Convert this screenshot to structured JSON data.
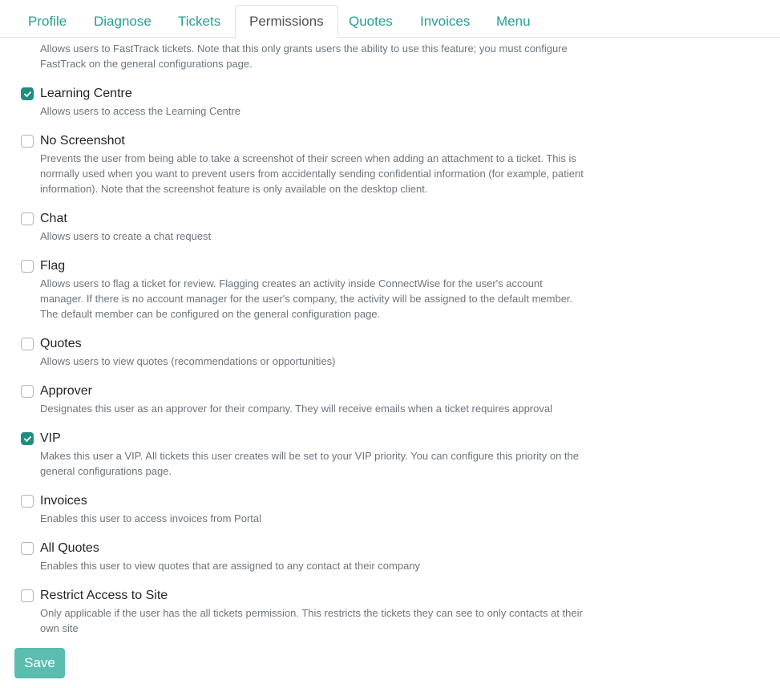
{
  "tabs": [
    {
      "label": "Profile",
      "active": false
    },
    {
      "label": "Diagnose",
      "active": false
    },
    {
      "label": "Tickets",
      "active": false
    },
    {
      "label": "Permissions",
      "active": true
    },
    {
      "label": "Quotes",
      "active": false
    },
    {
      "label": "Invoices",
      "active": false
    },
    {
      "label": "Menu",
      "active": false
    }
  ],
  "intro_description": "Allows users to FastTrack tickets. Note that this only grants users the ability to use this feature; you must configure FastTrack on the general configurations page.",
  "permissions": [
    {
      "label": "Learning Centre",
      "checked": true,
      "description": "Allows users to access the Learning Centre"
    },
    {
      "label": "No Screenshot",
      "checked": false,
      "description": "Prevents the user from being able to take a screenshot of their screen when adding an attachment to a ticket. This is normally used when you want to prevent users from accidentally sending confidential information (for example, patient information). Note that the screenshot feature is only available on the desktop client."
    },
    {
      "label": "Chat",
      "checked": false,
      "description": "Allows users to create a chat request"
    },
    {
      "label": "Flag",
      "checked": false,
      "description": "Allows users to flag a ticket for review. Flagging creates an activity inside ConnectWise for the user's account manager. If there is no account manager for the user's company, the activity will be assigned to the default member. The default member can be configured on the general configuration page."
    },
    {
      "label": "Quotes",
      "checked": false,
      "description": "Allows users to view quotes (recommendations or opportunities)"
    },
    {
      "label": "Approver",
      "checked": false,
      "description": "Designates this user as an approver for their company. They will receive emails when a ticket requires approval"
    },
    {
      "label": "VIP",
      "checked": true,
      "description": "Makes this user a VIP. All tickets this user creates will be set to your VIP priority. You can configure this priority on the general configurations page."
    },
    {
      "label": "Invoices",
      "checked": false,
      "description": "Enables this user to access invoices from Portal"
    },
    {
      "label": "All Quotes",
      "checked": false,
      "description": "Enables this user to view quotes that are assigned to any contact at their company"
    },
    {
      "label": "Restrict Access to Site",
      "checked": false,
      "description": "Only applicable if the user has the all tickets permission. This restricts the tickets they can see to only contacts at their own site"
    }
  ],
  "save_label": "Save",
  "colors": {
    "accent": "#2a9d8f",
    "checkbox_checked": "#1d8f7c",
    "save_button": "#5bbdb0"
  }
}
